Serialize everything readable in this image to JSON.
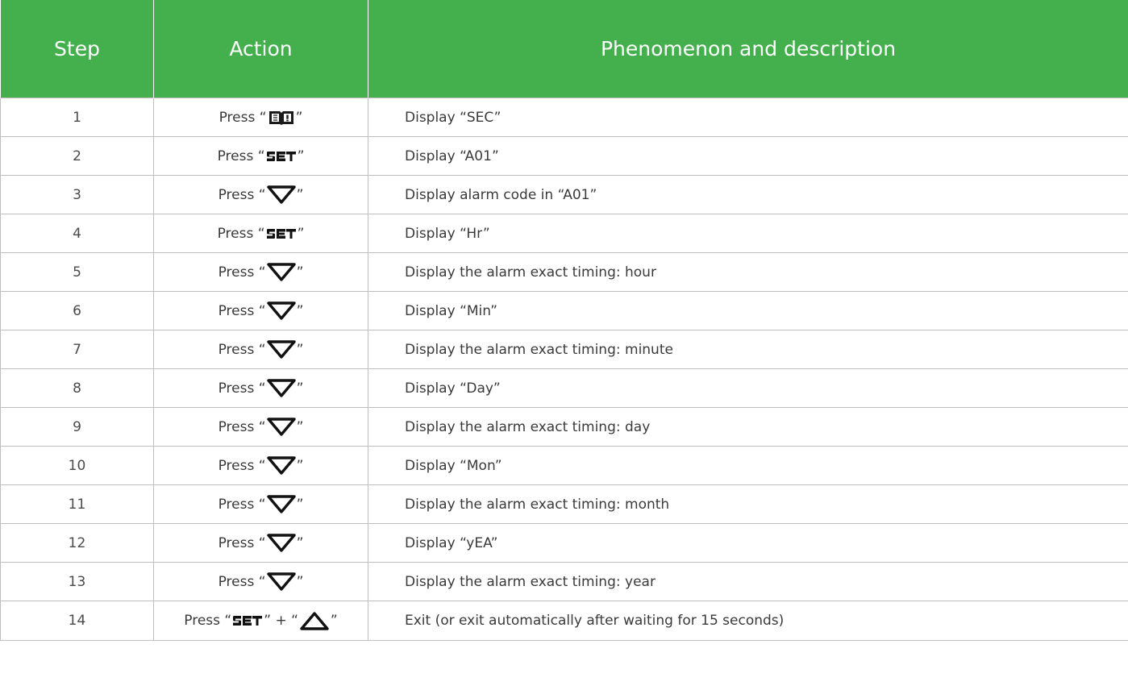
{
  "headers": {
    "step": "Step",
    "action": "Action",
    "description": "Phenomenon and description"
  },
  "colors": {
    "header_bg": "#44b04d",
    "header_text": "#ffffff",
    "grid": "#bfbfbf"
  },
  "keys": {
    "book": "book-icon",
    "set": "set-key-icon",
    "down": "down-triangle-icon",
    "up": "up-triangle-icon"
  },
  "rows": [
    {
      "step": "1",
      "action": {
        "press": "Press",
        "open": "“",
        "close": " ”",
        "key": "book"
      },
      "description": "Display “SEC”"
    },
    {
      "step": "2",
      "action": {
        "press": "Press",
        "open": "“",
        "close": "”",
        "key": "set"
      },
      "description": "Display “A01”"
    },
    {
      "step": "3",
      "action": {
        "press": "Press",
        "open": "“",
        "close": "”",
        "key": "down"
      },
      "description": "Display alarm code in “A01”"
    },
    {
      "step": "4",
      "action": {
        "press": "Press",
        "open": "“",
        "close": "”",
        "key": "set"
      },
      "description": "Display “Hr”"
    },
    {
      "step": "5",
      "action": {
        "press": "Press",
        "open": "“",
        "close": "”",
        "key": "down"
      },
      "description": "Display the alarm exact timing: hour"
    },
    {
      "step": "6",
      "action": {
        "press": "Press",
        "open": "“",
        "close": "”",
        "key": "down"
      },
      "description": "Display “Min”"
    },
    {
      "step": "7",
      "action": {
        "press": "Press",
        "open": "“",
        "close": "”",
        "key": "down"
      },
      "description": "Display the alarm exact timing: minute"
    },
    {
      "step": "8",
      "action": {
        "press": "Press",
        "open": "“",
        "close": "”",
        "key": "down"
      },
      "description": "Display “Day”"
    },
    {
      "step": "9",
      "action": {
        "press": "Press",
        "open": "“",
        "close": "”",
        "key": "down"
      },
      "description": "Display the alarm exact timing: day"
    },
    {
      "step": "10",
      "action": {
        "press": "Press",
        "open": "“",
        "close": "”",
        "key": "down"
      },
      "description": "Display “Mon”"
    },
    {
      "step": "11",
      "action": {
        "press": "Press",
        "open": "“",
        "close": "”",
        "key": "down"
      },
      "description": "Display the alarm exact timing: month"
    },
    {
      "step": "12",
      "action": {
        "press": "Press",
        "open": "“",
        "close": "”",
        "key": "down"
      },
      "description": "Display “yEA”"
    },
    {
      "step": "13",
      "action": {
        "press": "Press",
        "open": "“",
        "close": "”",
        "key": "down"
      },
      "description": "Display the alarm exact timing: year"
    },
    {
      "step": "14",
      "action": {
        "press": "Press",
        "open": "“",
        "close": "”",
        "key": "set",
        "plus": " + ",
        "open2": "“",
        "close2": "”",
        "key2": "up"
      },
      "description": "Exit (or exit automatically after waiting for 15 seconds)"
    }
  ]
}
